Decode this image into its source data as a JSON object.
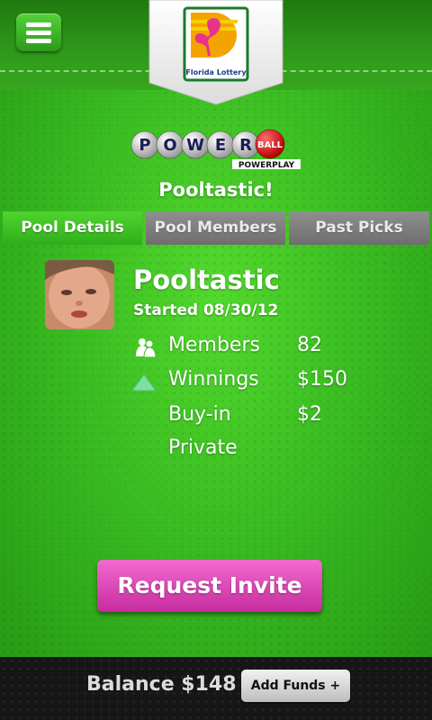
{
  "header": {
    "menu_icon": "hamburger-menu-icon",
    "brand_logo": {
      "icon": "flamingo-logo-icon",
      "text": "Florida Lottery"
    }
  },
  "game_logo": {
    "icon": "powerball-logo-icon",
    "text": "POWERBALL",
    "subtext": "POWERPLAY"
  },
  "pool_title": "Pooltastic!",
  "tabs": [
    {
      "label": "Pool Details",
      "active": true
    },
    {
      "label": "Pool Members",
      "active": false
    },
    {
      "label": "Past Picks",
      "active": false
    }
  ],
  "pool": {
    "name": "Pooltastic",
    "started": "Started 08/30/12",
    "avatar": "baby-photo",
    "stats": [
      {
        "icon": "members-icon",
        "label": "Members",
        "value": "82"
      },
      {
        "icon": "up-arrow-icon",
        "label": "Winnings",
        "value": "$150"
      },
      {
        "icon": "",
        "label": "Buy-in",
        "value": "$2"
      },
      {
        "icon": "",
        "label": "Private",
        "value": ""
      }
    ]
  },
  "actions": {
    "request_invite": "Request Invite"
  },
  "footer": {
    "balance": "Balance $148",
    "add_funds": "Add Funds +"
  },
  "colors": {
    "green": "#3bbd22",
    "magenta": "#d63aae",
    "gray_tab": "#7a7a7a",
    "footer": "#161616"
  }
}
